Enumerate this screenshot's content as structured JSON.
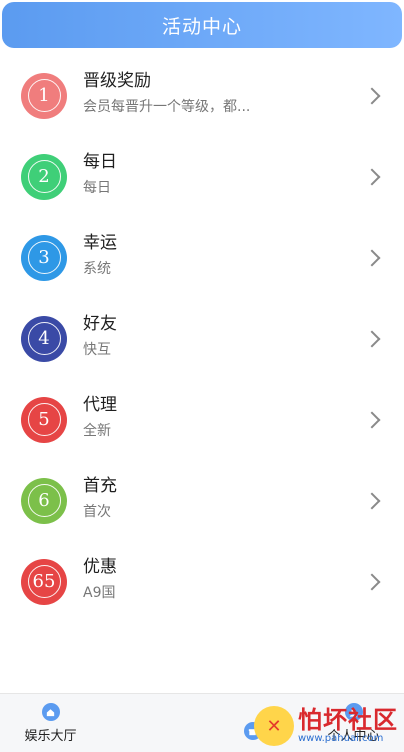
{
  "header": {
    "title": "活动中心"
  },
  "activities": [
    {
      "number": "1",
      "color": "#f07d7d",
      "title": "晋级奖励",
      "subtitle": "会员每晋升一个等级，都..."
    },
    {
      "number": "2",
      "color": "#3fcf78",
      "title": "每日",
      "subtitle": "每日"
    },
    {
      "number": "3",
      "color": "#2e98e6",
      "title": "幸运",
      "subtitle": "系统"
    },
    {
      "number": "4",
      "color": "#3a4aa6",
      "title": "好友",
      "subtitle": "快互"
    },
    {
      "number": "5",
      "color": "#e64545",
      "title": "代理",
      "subtitle": "全新"
    },
    {
      "number": "6",
      "color": "#7cc04a",
      "title": "首充",
      "subtitle": "首次"
    },
    {
      "number": "65",
      "color": "#e64545",
      "title": "优惠",
      "subtitle": "A9国"
    }
  ],
  "tabbar": {
    "tabs": [
      {
        "label": "娱乐大厅",
        "icon": "home-icon"
      },
      {
        "label": "",
        "icon": ""
      },
      {
        "label": "",
        "icon": "gift-icon"
      },
      {
        "label": "个人中心",
        "icon": "user-icon"
      }
    ]
  },
  "watermark": {
    "text": "怕坏社区",
    "url": "www.pahuai.com"
  }
}
